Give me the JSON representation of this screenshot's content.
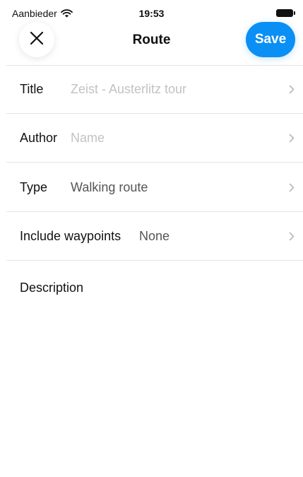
{
  "status_bar": {
    "carrier": "Aanbieder",
    "time": "19:53"
  },
  "header": {
    "title": "Route",
    "save_label": "Save",
    "close_icon": "close-icon"
  },
  "form": {
    "rows": [
      {
        "label": "Title",
        "value": "Zeist - Austerlitz tour",
        "is_placeholder": true
      },
      {
        "label": "Author",
        "value": "Name",
        "is_placeholder": true
      },
      {
        "label": "Type",
        "value": "Walking route",
        "is_placeholder": false
      },
      {
        "label": "Include waypoints",
        "value": "None",
        "is_placeholder": false
      }
    ],
    "description_label": "Description"
  },
  "colors": {
    "accent": "#0a8ff5",
    "placeholder": "#c2c2c4",
    "value": "#555555",
    "divider": "#e4e4e4"
  }
}
